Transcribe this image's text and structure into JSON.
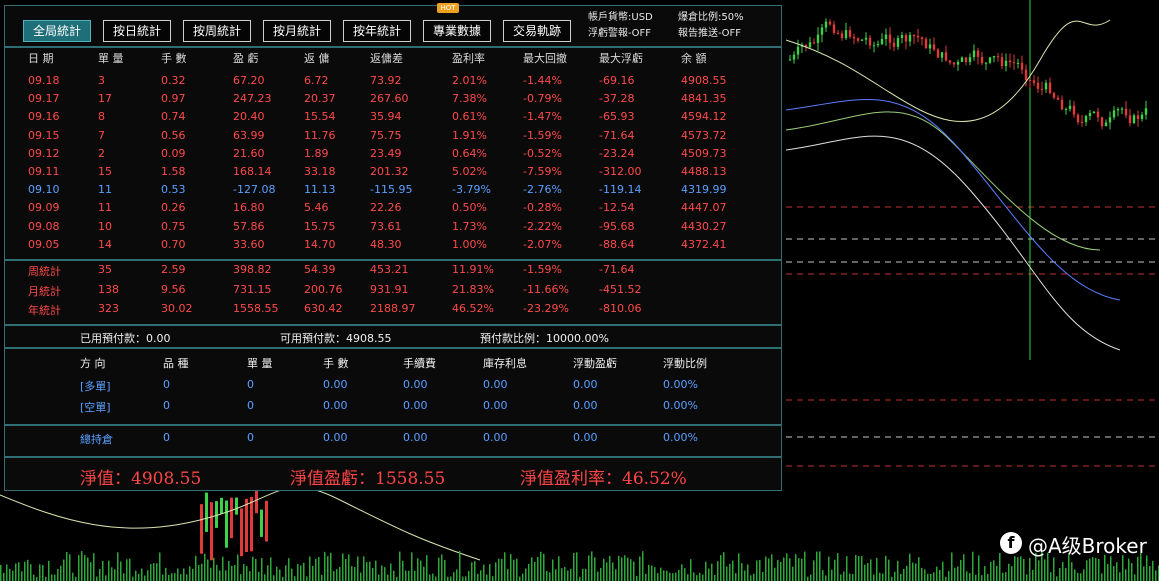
{
  "tabs": [
    {
      "label": "全局統計",
      "active": true
    },
    {
      "label": "按日統計"
    },
    {
      "label": "按周統計"
    },
    {
      "label": "按月統計"
    },
    {
      "label": "按年統計"
    },
    {
      "label": "專業數據"
    },
    {
      "label": "交易軌跡"
    }
  ],
  "hot_badge": "HOT",
  "account": {
    "currency": "帳戶貨幣:USD",
    "position_ratio": "爆倉比例:50%",
    "float_alarm": "浮虧警報-OFF",
    "report_push": "報告推送-OFF"
  },
  "daily": {
    "headers": [
      "日 期",
      "單 量",
      "手 數",
      "盈 虧",
      "返 傭",
      "返傭差",
      "盈利率",
      "最大回撤",
      "最大浮虧",
      "余 額"
    ],
    "rows": [
      {
        "c": [
          "09.18",
          "3",
          "0.32",
          "67.20",
          "6.72",
          "73.92",
          "2.01%",
          "-1.44%",
          "-69.16",
          "4908.55"
        ],
        "color": "red"
      },
      {
        "c": [
          "09.17",
          "17",
          "0.97",
          "247.23",
          "20.37",
          "267.60",
          "7.38%",
          "-0.79%",
          "-37.28",
          "4841.35"
        ],
        "color": "red"
      },
      {
        "c": [
          "09.16",
          "8",
          "0.74",
          "20.40",
          "15.54",
          "35.94",
          "0.61%",
          "-1.47%",
          "-65.93",
          "4594.12"
        ],
        "color": "red"
      },
      {
        "c": [
          "09.15",
          "7",
          "0.56",
          "63.99",
          "11.76",
          "75.75",
          "1.91%",
          "-1.59%",
          "-71.64",
          "4573.72"
        ],
        "color": "red"
      },
      {
        "c": [
          "09.12",
          "2",
          "0.09",
          "21.60",
          "1.89",
          "23.49",
          "0.64%",
          "-0.52%",
          "-23.24",
          "4509.73"
        ],
        "color": "red"
      },
      {
        "c": [
          "09.11",
          "15",
          "1.58",
          "168.14",
          "33.18",
          "201.32",
          "5.02%",
          "-7.59%",
          "-312.00",
          "4488.13"
        ],
        "color": "red"
      },
      {
        "c": [
          "09.10",
          "11",
          "0.53",
          "-127.08",
          "11.13",
          "-115.95",
          "-3.79%",
          "-2.76%",
          "-119.14",
          "4319.99"
        ],
        "color": "blue"
      },
      {
        "c": [
          "09.09",
          "11",
          "0.26",
          "16.80",
          "5.46",
          "22.26",
          "0.50%",
          "-0.28%",
          "-12.54",
          "4447.07"
        ],
        "color": "red"
      },
      {
        "c": [
          "09.08",
          "10",
          "0.75",
          "57.86",
          "15.75",
          "73.61",
          "1.73%",
          "-2.22%",
          "-95.68",
          "4430.27"
        ],
        "color": "red"
      },
      {
        "c": [
          "09.05",
          "14",
          "0.70",
          "33.60",
          "14.70",
          "48.30",
          "1.00%",
          "-2.07%",
          "-88.64",
          "4372.41"
        ],
        "color": "red"
      }
    ]
  },
  "period": [
    {
      "c": [
        "周統計",
        "35",
        "2.59",
        "398.82",
        "54.39",
        "453.21",
        "11.91%",
        "-1.59%",
        "-71.64"
      ]
    },
    {
      "c": [
        "月統計",
        "138",
        "9.56",
        "731.15",
        "200.76",
        "931.91",
        "21.83%",
        "-11.66%",
        "-451.52"
      ]
    },
    {
      "c": [
        "年統計",
        "323",
        "30.02",
        "1558.55",
        "630.42",
        "2188.97",
        "46.52%",
        "-23.29%",
        "-810.06"
      ]
    }
  ],
  "prepay": {
    "used": "已用預付款：0.00",
    "available": "可用預付款：4908.55",
    "ratio": "預付款比例：10000.00%"
  },
  "positions": {
    "headers": [
      "方 向",
      "品 種",
      "單 量",
      "手 數",
      "手續費",
      "庫存利息",
      "浮動盈虧",
      "浮動比例"
    ],
    "rows": [
      {
        "c": [
          "[多單]",
          "0",
          "0",
          "0.00",
          "0.00",
          "0.00",
          "0.00",
          "0.00%"
        ]
      },
      {
        "c": [
          "[空單]",
          "0",
          "0",
          "0.00",
          "0.00",
          "0.00",
          "0.00",
          "0.00%"
        ]
      }
    ],
    "total": {
      "c": [
        "總持倉",
        "0",
        "0",
        "0.00",
        "0.00",
        "0.00",
        "0.00",
        "0.00%"
      ]
    }
  },
  "summary": {
    "equity": "淨值：4908.55",
    "equity_pl": "淨值盈虧：1558.55",
    "equity_rate": "淨值盈利率：46.52%"
  },
  "watermark": "@A级Broker",
  "colors": {
    "profit": "#ff4a4a",
    "loss": "#5aa0ff",
    "accent": "#1f6f78",
    "border": "#2f6f73",
    "label": "#d8a14a"
  }
}
